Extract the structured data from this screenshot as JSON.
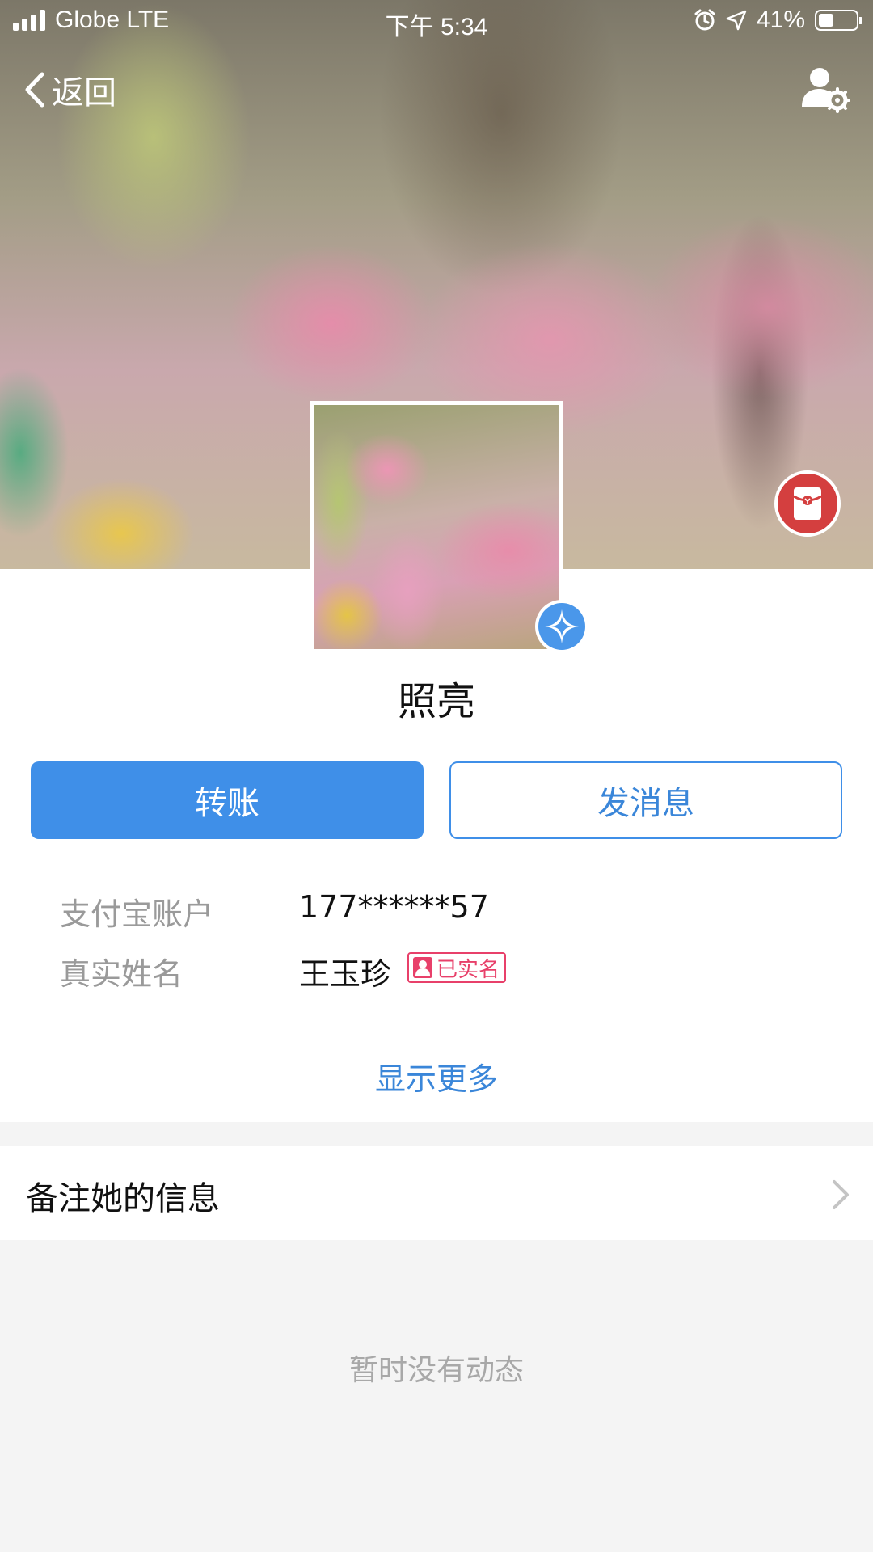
{
  "status_bar": {
    "carrier": "Globe LTE",
    "time": "下午 5:34",
    "battery_percent": "41%",
    "battery_level": 0.41,
    "icons": [
      "signal-icon",
      "alarm-icon",
      "location-arrow-icon",
      "battery-icon"
    ]
  },
  "nav": {
    "back_label": "返回",
    "back_icon": "chevron-left-icon",
    "settings_icon": "user-settings-icon"
  },
  "profile": {
    "name": "照亮",
    "verified_icon": "verified-star-icon",
    "red_envelope_icon": "red-envelope-icon"
  },
  "actions": {
    "transfer_label": "转账",
    "message_label": "发消息"
  },
  "info": {
    "account_label": "支付宝账户",
    "account_value": "177******57",
    "realname_label": "真实姓名",
    "realname_value": "王玉珍",
    "realname_badge": "已实名"
  },
  "show_more_label": "显示更多",
  "remark": {
    "label": "备注她的信息"
  },
  "empty_state": "暂时没有动态",
  "colors": {
    "accent_blue": "#3f8fe8",
    "link_blue": "#3a86d9",
    "badge_pink": "#e8406a",
    "envelope_red": "#d43f3f"
  }
}
